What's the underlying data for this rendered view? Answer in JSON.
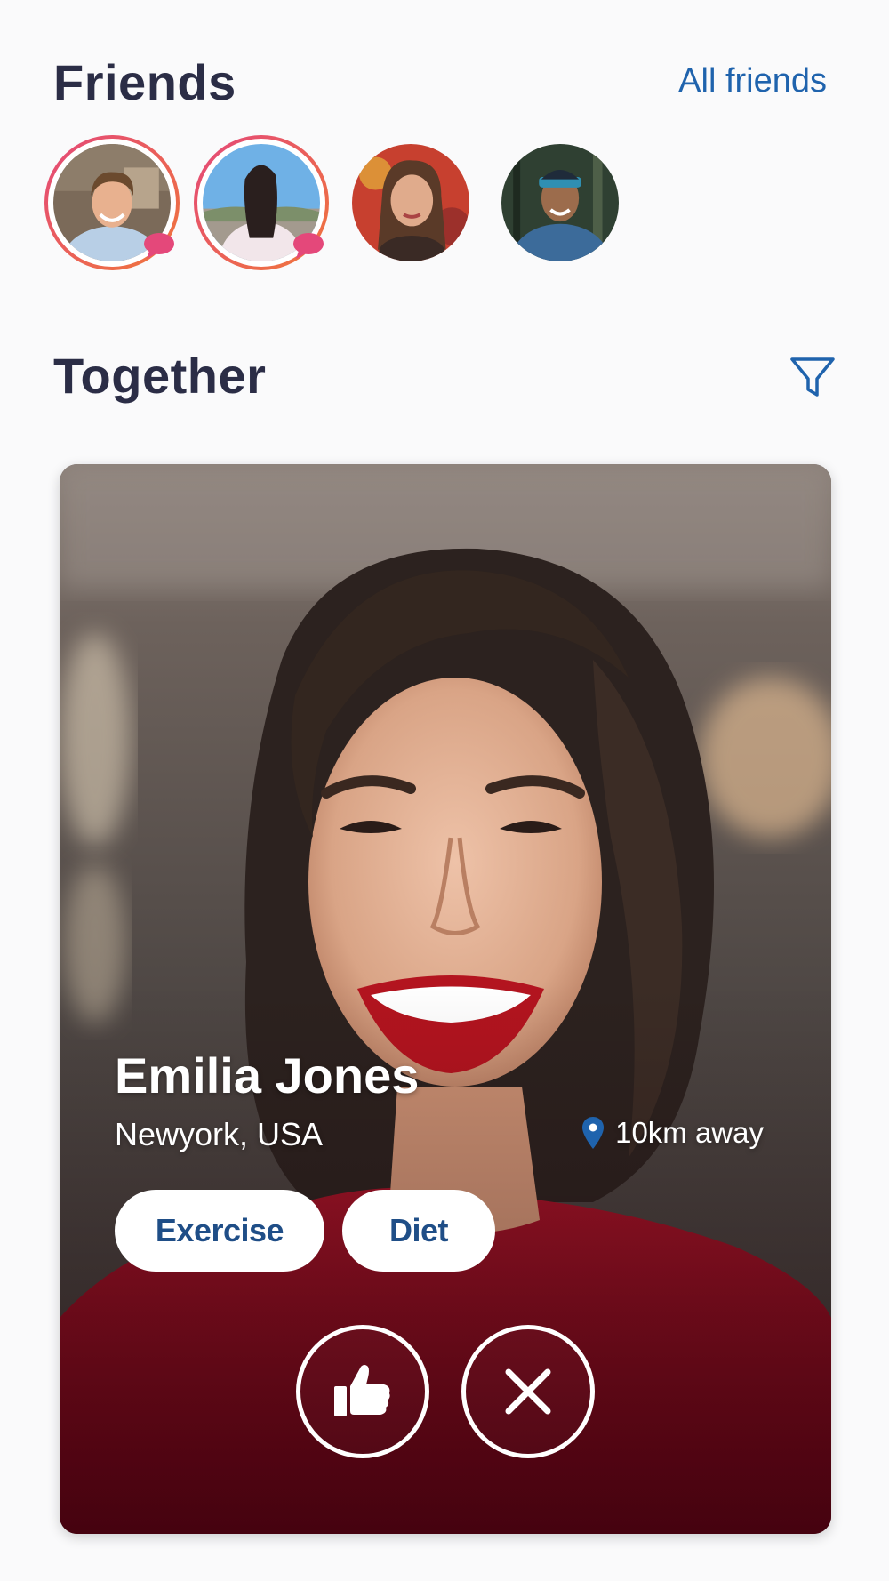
{
  "friends": {
    "title": "Friends",
    "all_friends_label": "All friends",
    "avatars": [
      {
        "name": "friend-avatar-1",
        "has_story": true,
        "has_message": true,
        "skin": "#e8b18f",
        "hair": "#6b4a2e",
        "bg": "#7b6a59",
        "shirt": "#b8cfe6"
      },
      {
        "name": "friend-avatar-2",
        "has_story": true,
        "has_message": true,
        "skin": "#d9b8a2",
        "hair": "#2a1f1e",
        "bg": "#6fb1e6",
        "shirt": "#f2e6ea"
      },
      {
        "name": "friend-avatar-3",
        "has_story": false,
        "has_message": false,
        "skin": "#e0ab8c",
        "hair": "#5a3a28",
        "bg": "#c7402f",
        "shirt": "#3a2a25"
      },
      {
        "name": "friend-avatar-4",
        "has_story": false,
        "has_message": false,
        "skin": "#9c6c4c",
        "hair": "#1f2b3a",
        "bg": "#2f4032",
        "shirt": "#3c6b9a"
      }
    ]
  },
  "together": {
    "title": "Together",
    "filter_icon": "filter-icon"
  },
  "profile_card": {
    "name": "Emilia Jones",
    "location": "Newyork, USA",
    "distance": "10km away",
    "tags": [
      "Exercise",
      "Diet"
    ],
    "like_icon": "thumbs-up-icon",
    "dismiss_icon": "close-icon"
  },
  "colors": {
    "heading": "#2b2d46",
    "link": "#1f63ad",
    "story_ring_start": "#e4487a",
    "story_ring_end": "#f0773a",
    "message_badge": "#e4487a",
    "tag_text": "#1f4e87",
    "pin": "#1f63ad"
  }
}
